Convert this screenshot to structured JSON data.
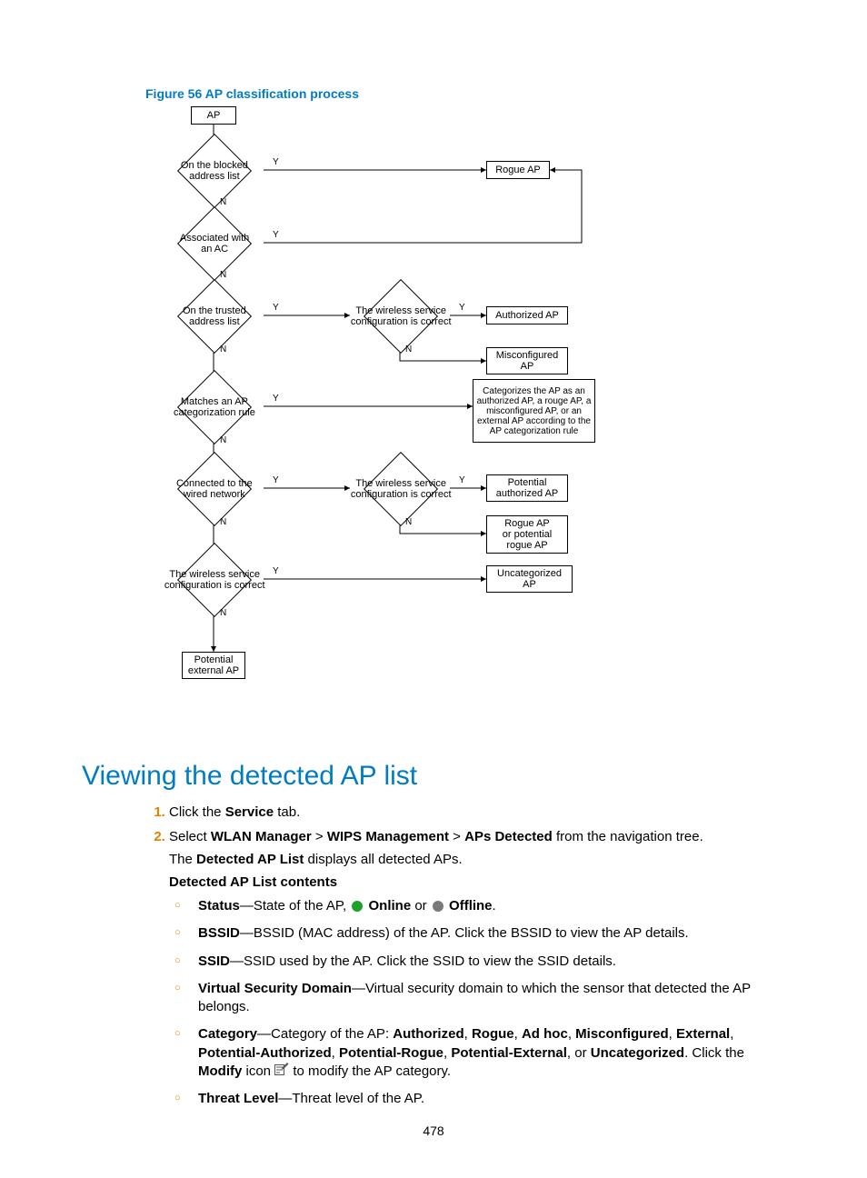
{
  "figure": {
    "title": "Figure 56 AP classification process"
  },
  "flow": {
    "start": "AP",
    "d1": "On the blocked\naddress list",
    "d2": "Associated with\nan AC",
    "d3": "On the trusted\naddress list",
    "d3b": "The wireless service\nconfiguration is correct",
    "d4": "Matches an AP\ncategorization rule",
    "d5": "Connected to the\nwired network",
    "d5b": "The wireless service\nconfiguration is correct",
    "d6": "The wireless service\nconfiguration is correct",
    "r_rogue": "Rogue AP",
    "r_auth": "Authorized AP",
    "r_mis": "Misconfigured\nAP",
    "r_catrule": "Categorizes the AP as an\nauthorized AP, a rouge AP, a\nmisconfigured AP, or an\nexternal AP according to the\nAP categorization rule",
    "r_pauth": "Potential\nauthorized AP",
    "r_prog": "Rogue AP\nor potential\nrogue AP",
    "r_uncat": "Uncategorized\nAP",
    "r_pext": "Potential\nexternal AP",
    "Y": "Y",
    "N": "N"
  },
  "heading": "Viewing the detected AP list",
  "steps": {
    "s1_pre": "Click the ",
    "s1_b": "Service",
    "s1_post": " tab.",
    "s2_pre": "Select ",
    "s2_b1": "WLAN Manager",
    "s2_sep": " > ",
    "s2_b2": "WIPS Management",
    "s2_b3": "APs Detected",
    "s2_post": " from the navigation tree.",
    "p_detected_pre": "The ",
    "p_detected_b": "Detected AP List",
    "p_detected_post": " displays all detected APs.",
    "sub": "Detected AP List contents",
    "b_status_t": "Status",
    "b_status_d1": "—State of the AP, ",
    "b_status_on": "Online",
    "b_status_or": " or ",
    "b_status_off": "Offline",
    "b_status_end": ".",
    "b_bssid_t": "BSSID",
    "b_bssid_d": "—BSSID (MAC address) of the AP. Click the BSSID to view the AP details.",
    "b_ssid_t": "SSID",
    "b_ssid_d": "—SSID used by the AP. Click the SSID to view the SSID details.",
    "b_vsd_t": "Virtual Security Domain",
    "b_vsd_d": "—Virtual security domain to which the sensor that detected the AP belongs.",
    "b_cat_t": "Category",
    "b_cat_d1": "—Category of the AP: ",
    "b_cat_v1": "Authorized",
    "b_cat_c": ", ",
    "b_cat_v2": "Rogue",
    "b_cat_v3": "Ad hoc",
    "b_cat_v4": "Misconfigured",
    "b_cat_v5": "External",
    "b_cat_v6": "Potential-Authorized",
    "b_cat_v7": "Potential-Rogue",
    "b_cat_v8": "Potential-External",
    "b_cat_or": ", or ",
    "b_cat_v9": "Uncategorized",
    "b_cat_d2": ". Click the ",
    "b_cat_mod": "Modify",
    "b_cat_d3": " icon ",
    "b_cat_d4": " to modify the AP category.",
    "b_thr_t": "Threat Level",
    "b_thr_d": "—Threat level of the AP."
  },
  "page_number": "478"
}
